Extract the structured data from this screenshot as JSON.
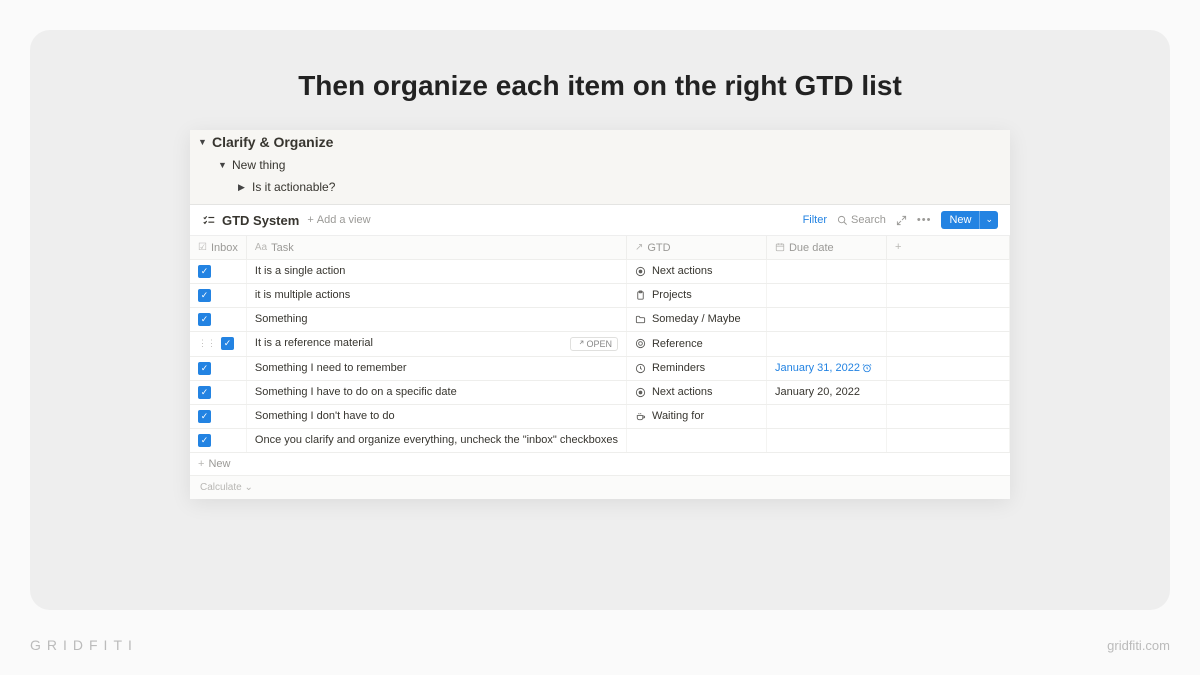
{
  "heading": "Then organize each item on the right GTD list",
  "toggles": {
    "root": "Clarify & Organize",
    "child1": "New thing",
    "child2": "Is it actionable?"
  },
  "db": {
    "title": "GTD System",
    "add_view": "Add a view",
    "actions": {
      "filter": "Filter",
      "search": "Search",
      "new": "New"
    },
    "columns": {
      "inbox": "Inbox",
      "task": "Task",
      "gtd": "GTD",
      "due": "Due date"
    },
    "open_label": "OPEN",
    "rows": [
      {
        "checked": true,
        "task": "It is a single action",
        "gtd_icon": "target",
        "gtd": "Next actions",
        "due": "",
        "hover": false
      },
      {
        "checked": true,
        "task": "it is multiple actions",
        "gtd_icon": "clipboard",
        "gtd": "Projects",
        "due": "",
        "hover": false
      },
      {
        "checked": true,
        "task": "Something",
        "gtd_icon": "folder",
        "gtd": "Someday / Maybe",
        "due": "",
        "hover": false
      },
      {
        "checked": true,
        "task": "It is a reference material",
        "gtd_icon": "book",
        "gtd": "Reference",
        "due": "",
        "hover": true
      },
      {
        "checked": true,
        "task": "Something I need to remember",
        "gtd_icon": "clock",
        "gtd": "Reminders",
        "due": "January 31, 2022",
        "due_link": true,
        "hover": false
      },
      {
        "checked": true,
        "task": "Something I have to do on a specific date",
        "gtd_icon": "target",
        "gtd": "Next actions",
        "due": "January 20, 2022",
        "due_link": false,
        "hover": false
      },
      {
        "checked": true,
        "task": "Something I don't have to do",
        "gtd_icon": "coffee",
        "gtd": "Waiting for",
        "due": "",
        "hover": false
      },
      {
        "checked": true,
        "task": "Once you clarify and organize everything, uncheck the \"inbox\" checkboxes",
        "gtd_icon": "",
        "gtd": "",
        "due": "",
        "hover": false
      }
    ],
    "new_row": "New",
    "calculate": "Calculate"
  },
  "branding": {
    "left": "GRIDFITI",
    "right": "gridfiti.com"
  }
}
